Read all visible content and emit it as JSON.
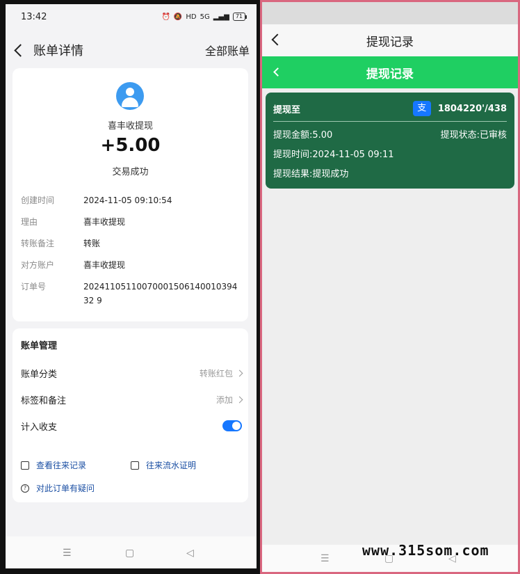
{
  "left": {
    "status_bar": {
      "time": "13:42",
      "battery": "71",
      "hd": "HD",
      "network": "5G"
    },
    "navbar": {
      "title": "账单详情",
      "right_link": "全部账单"
    },
    "transaction": {
      "payee": "喜丰收提现",
      "amount": "+5.00",
      "status": "交易成功"
    },
    "details": [
      {
        "label": "创建时间",
        "value": "2024-11-05 09:10:54"
      },
      {
        "label": "理由",
        "value": "喜丰收提现"
      },
      {
        "label": "转账备注",
        "value": "转账"
      },
      {
        "label": "对方账户",
        "value": "喜丰收提现"
      },
      {
        "label": "订单号",
        "value": "2024110511007000150614001039432 9"
      }
    ],
    "management": {
      "title": "账单管理",
      "category_label": "账单分类",
      "category_value": "转账红包",
      "tags_label": "标签和备注",
      "tags_value": "添加",
      "income_label": "计入收支",
      "link_history": "查看往来记录",
      "link_proof": "往来流水证明",
      "link_question": "对此订单有疑问"
    }
  },
  "right": {
    "nav_title": "提现记录",
    "header_title": "提现记录",
    "card": {
      "to_label": "提现至",
      "account": "1804220'/438",
      "amount_text": "提现金额:5.00",
      "status_text": "提现状态:已审核",
      "time_text": "提现时间:2024-11-05 09:11",
      "result_text": "提现结果:提现成功"
    },
    "watermark": "www.315som.com"
  },
  "colors": {
    "accent_blue": "#1677ff",
    "green_header": "#1fcf62",
    "card_green": "#1f6a45",
    "frame_pink": "#d9677f"
  }
}
